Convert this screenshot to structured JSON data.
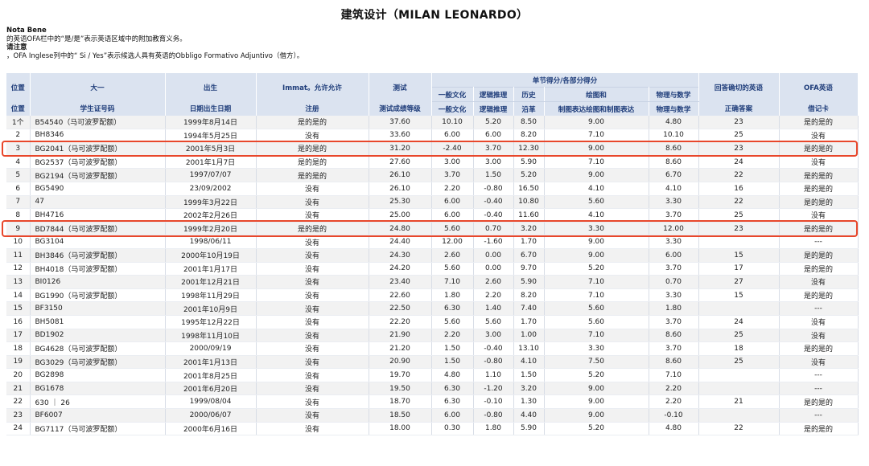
{
  "page": {
    "title": "建筑设计（MILAN LEONARDO）",
    "notes": {
      "nota_bene_label": "Nota Bene",
      "nota_bene_text": "的英语OFA栏中的“是/是”表示英语区域中的附加教育义务。",
      "attenzione_label": "请注意",
      "attenzione_text": "，OFA Inglese列中的“ Si / Yes”表示候选人具有英语的Obbligo Formativo Adjuntivo（借方）。"
    }
  },
  "table": {
    "header": {
      "pos_1": "位置",
      "pos_2": "位置",
      "major_1": "大一",
      "major_2": "学生证号码",
      "birth_1": "出生",
      "birth_2": "日期出生日期",
      "immat_1": "Immat。允许允许",
      "immat_2": "注册",
      "test_1": "测试",
      "test_2": "测试成绩等级",
      "sections_label": "单节得分/各部分得分",
      "cult_1": "一般文化",
      "cult_2": "一般文化",
      "logic_1": "逻辑推理",
      "logic_2": "逻辑推理",
      "hist_1": "历史",
      "hist_2": "沿革",
      "draw_1": "绘图和",
      "draw_2": "制图表达绘图和制图表达",
      "phys_1": "物理与数学",
      "phys_2": "物理与数学",
      "correct_1": "回答确切的英语",
      "correct_2": "正确答案",
      "ofa_1": "OFA英语",
      "ofa_2": "借记卡"
    },
    "rows": [
      {
        "pos": "1个",
        "id": "B54540（马可波罗配额）",
        "birth": "1999年8月14日",
        "immat": "是的是的",
        "score": "37.60",
        "cult": "10.10",
        "logic": "5.20",
        "hist": "8.50",
        "draw": "9.00",
        "phys": "4.80",
        "correct": "23",
        "ofa": "是的是的"
      },
      {
        "pos": "2",
        "id": "BH8346",
        "birth": "1994年5月25日",
        "immat": "没有",
        "score": "33.60",
        "cult": "6.00",
        "logic": "6.00",
        "hist": "8.20",
        "draw": "7.10",
        "phys": "10.10",
        "correct": "25",
        "ofa": "没有"
      },
      {
        "pos": "3",
        "id": "BG2041（马可波罗配额）",
        "birth": "2001年5月3日",
        "immat": "是的是的",
        "score": "31.20",
        "cult": "-2.40",
        "logic": "3.70",
        "hist": "12.30",
        "draw": "9.00",
        "phys": "8.60",
        "correct": "23",
        "ofa": "是的是的"
      },
      {
        "pos": "4",
        "id": "BG2537（马可波罗配额）",
        "birth": "2001年1月7日",
        "immat": "是的是的",
        "score": "27.60",
        "cult": "3.00",
        "logic": "3.00",
        "hist": "5.90",
        "draw": "7.10",
        "phys": "8.60",
        "correct": "24",
        "ofa": "没有"
      },
      {
        "pos": "5",
        "id": "BG2194（马可波罗配额）",
        "birth": "1997/07/07",
        "immat": "是的是的",
        "score": "26.10",
        "cult": "3.70",
        "logic": "1.50",
        "hist": "5.20",
        "draw": "9.00",
        "phys": "6.70",
        "correct": "22",
        "ofa": "是的是的"
      },
      {
        "pos": "6",
        "id": "BG5490",
        "birth": "23/09/2002",
        "immat": "没有",
        "score": "26.10",
        "cult": "2.20",
        "logic": "-0.80",
        "hist": "16.50",
        "draw": "4.10",
        "phys": "4.10",
        "correct": "16",
        "ofa": "是的是的"
      },
      {
        "pos": "7",
        "id": "47",
        "birth": "1999年3月22日",
        "immat": "没有",
        "score": "25.30",
        "cult": "6.00",
        "logic": "-0.40",
        "hist": "10.80",
        "draw": "5.60",
        "phys": "3.30",
        "correct": "22",
        "ofa": "是的是的"
      },
      {
        "pos": "8",
        "id": "BH4716",
        "birth": "2002年2月26日",
        "immat": "没有",
        "score": "25.00",
        "cult": "6.00",
        "logic": "-0.40",
        "hist": "11.60",
        "draw": "4.10",
        "phys": "3.70",
        "correct": "25",
        "ofa": "没有"
      },
      {
        "pos": "9",
        "id": "BD7844（马可波罗配额）",
        "birth": "1999年2月20日",
        "immat": "是的是的",
        "score": "24.80",
        "cult": "5.60",
        "logic": "0.70",
        "hist": "3.20",
        "draw": "3.30",
        "phys": "12.00",
        "correct": "23",
        "ofa": "是的是的"
      },
      {
        "pos": "10",
        "id": "BG3104",
        "birth": "1998/06/11",
        "immat": "没有",
        "score": "24.40",
        "cult": "12.00",
        "logic": "-1.60",
        "hist": "1.70",
        "draw": "9.00",
        "phys": "3.30",
        "correct": "",
        "ofa": "---"
      },
      {
        "pos": "11",
        "id": "BH3846（马可波罗配额）",
        "birth": "2000年10月19日",
        "immat": "没有",
        "score": "24.30",
        "cult": "2.60",
        "logic": "0.00",
        "hist": "6.70",
        "draw": "9.00",
        "phys": "6.00",
        "correct": "15",
        "ofa": "是的是的"
      },
      {
        "pos": "12",
        "id": "BH4018（马可波罗配额）",
        "birth": "2001年1月17日",
        "immat": "没有",
        "score": "24.20",
        "cult": "5.60",
        "logic": "0.00",
        "hist": "9.70",
        "draw": "5.20",
        "phys": "3.70",
        "correct": "17",
        "ofa": "是的是的"
      },
      {
        "pos": "13",
        "id": "BI0126",
        "birth": "2001年12月21日",
        "immat": "没有",
        "score": "23.40",
        "cult": "7.10",
        "logic": "2.60",
        "hist": "5.90",
        "draw": "7.10",
        "phys": "0.70",
        "correct": "27",
        "ofa": "没有"
      },
      {
        "pos": "14",
        "id": "BG1990（马可波罗配额）",
        "birth": "1998年11月29日",
        "immat": "没有",
        "score": "22.60",
        "cult": "1.80",
        "logic": "2.20",
        "hist": "8.20",
        "draw": "7.10",
        "phys": "3.30",
        "correct": "15",
        "ofa": "是的是的"
      },
      {
        "pos": "15",
        "id": "BF3150",
        "birth": "2001年10月9日",
        "immat": "没有",
        "score": "22.50",
        "cult": "6.30",
        "logic": "1.40",
        "hist": "7.40",
        "draw": "5.60",
        "phys": "1.80",
        "correct": "",
        "ofa": "---"
      },
      {
        "pos": "16",
        "id": "BH5081",
        "birth": "1995年12月22日",
        "immat": "没有",
        "score": "22.20",
        "cult": "5.60",
        "logic": "5.60",
        "hist": "1.70",
        "draw": "5.60",
        "phys": "3.70",
        "correct": "24",
        "ofa": "没有"
      },
      {
        "pos": "17",
        "id": "BD1902",
        "birth": "1998年11月10日",
        "immat": "没有",
        "score": "21.90",
        "cult": "2.20",
        "logic": "3.00",
        "hist": "1.00",
        "draw": "7.10",
        "phys": "8.60",
        "correct": "25",
        "ofa": "没有"
      },
      {
        "pos": "18",
        "id": "BG4628（马可波罗配额）",
        "birth": "2000/09/19",
        "immat": "没有",
        "score": "21.20",
        "cult": "1.50",
        "logic": "-0.40",
        "hist": "13.10",
        "draw": "3.30",
        "phys": "3.70",
        "correct": "18",
        "ofa": "是的是的"
      },
      {
        "pos": "19",
        "id": "BG3029（马可波罗配额）",
        "birth": "2001年1月13日",
        "immat": "没有",
        "score": "20.90",
        "cult": "1.50",
        "logic": "-0.80",
        "hist": "4.10",
        "draw": "7.50",
        "phys": "8.60",
        "correct": "25",
        "ofa": "没有"
      },
      {
        "pos": "20",
        "id": "BG2898",
        "birth": "2001年8月25日",
        "immat": "没有",
        "score": "19.70",
        "cult": "4.80",
        "logic": "1.10",
        "hist": "1.50",
        "draw": "5.20",
        "phys": "7.10",
        "correct": "",
        "ofa": "---"
      },
      {
        "pos": "21",
        "id": "BG1678",
        "birth": "2001年6月20日",
        "immat": "没有",
        "score": "19.50",
        "cult": "6.30",
        "logic": "-1.20",
        "hist": "3.20",
        "draw": "9.00",
        "phys": "2.20",
        "correct": "",
        "ofa": "---"
      },
      {
        "pos": "22",
        "id": "630 ｜ 26",
        "birth": "1999/08/04",
        "immat": "没有",
        "score": "18.70",
        "cult": "6.30",
        "logic": "-0.10",
        "hist": "1.30",
        "draw": "9.00",
        "phys": "2.20",
        "correct": "21",
        "ofa": "是的是的"
      },
      {
        "pos": "23",
        "id": "BF6007",
        "birth": "2000/06/07",
        "immat": "没有",
        "score": "18.50",
        "cult": "6.00",
        "logic": "-0.80",
        "hist": "4.40",
        "draw": "9.00",
        "phys": "-0.10",
        "correct": "",
        "ofa": "---"
      },
      {
        "pos": "24",
        "id": "BG7117（马可波罗配额）",
        "birth": "2000年6月16日",
        "immat": "没有",
        "score": "18.00",
        "cult": "0.30",
        "logic": "1.80",
        "hist": "5.90",
        "draw": "5.20",
        "phys": "4.80",
        "correct": "22",
        "ofa": "是的是的"
      }
    ]
  },
  "highlight_color": "#e8472b",
  "header_bg": "#dbe3f0",
  "header_text_color": "#1f3d7a"
}
